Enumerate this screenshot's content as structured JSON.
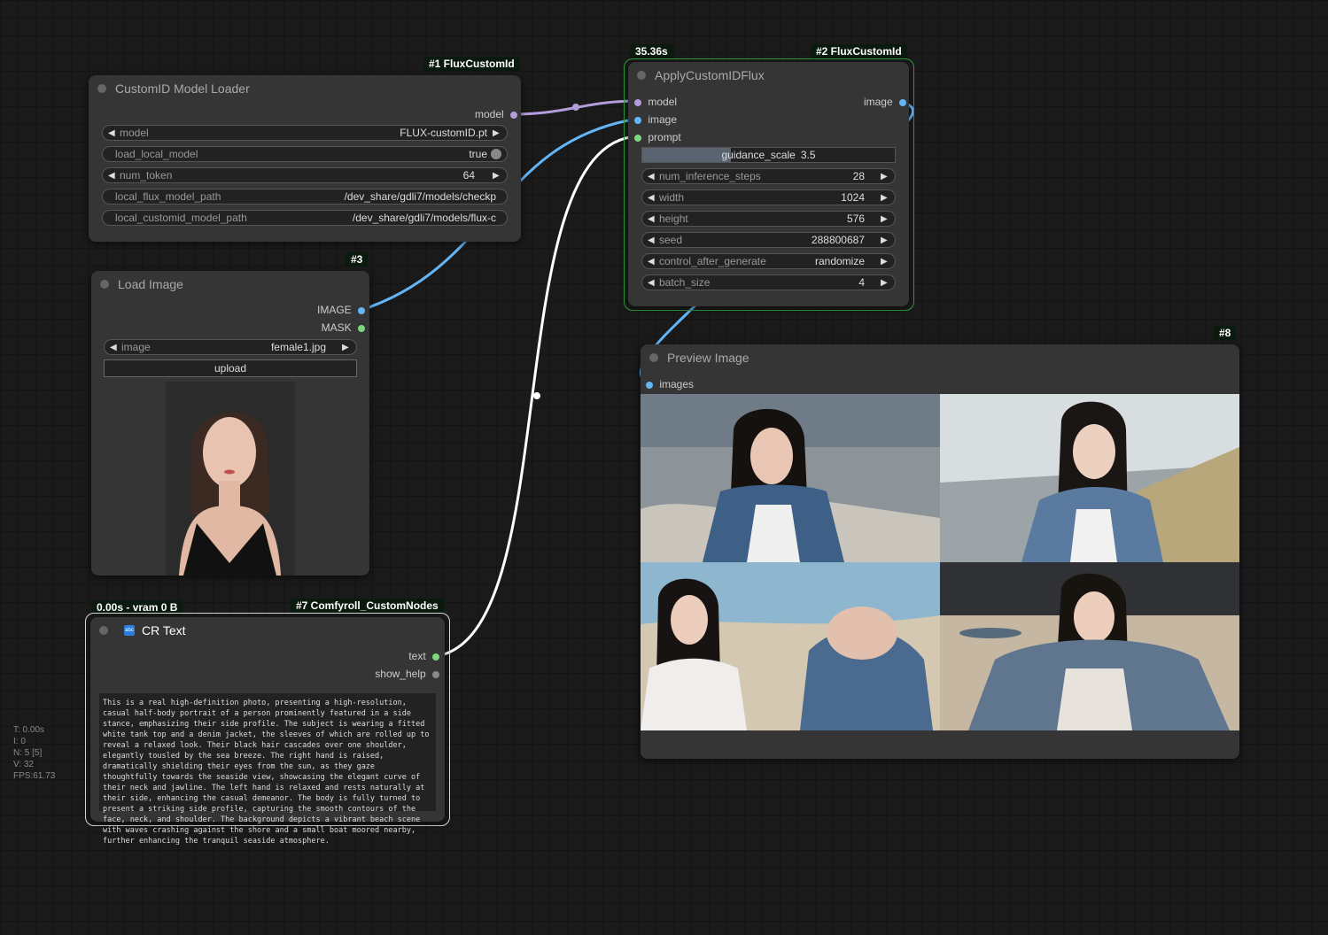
{
  "canvas_stats": {
    "t": "T: 0.00s",
    "i": "I: 0",
    "n": "N: 5 [5]",
    "v": "V: 32",
    "fps": "FPS:61.73"
  },
  "node1": {
    "badge": "#1 FluxCustomId",
    "title": "CustomID Model Loader",
    "output": "model",
    "widgets": {
      "model_label": "model",
      "model_value": "FLUX-customID.pt",
      "load_local_label": "load_local_model",
      "load_local_value": "true",
      "num_token_label": "num_token",
      "num_token_value": "64",
      "flux_path_label": "local_flux_model_path",
      "flux_path_value": "/dev_share/gdli7/models/checkp",
      "customid_path_label": "local_customid_model_path",
      "customid_path_value": "/dev_share/gdli7/models/flux-c"
    }
  },
  "node2": {
    "timing": "35.36s",
    "badge": "#2 FluxCustomId",
    "title": "ApplyCustomIDFlux",
    "inputs": {
      "model": "model",
      "image": "image",
      "prompt": "prompt"
    },
    "output": "image",
    "widgets": {
      "guidance_label": "guidance_scale",
      "guidance_value": "3.5",
      "guidance_fill": 0.35,
      "steps_label": "num_inference_steps",
      "steps_value": "28",
      "width_label": "width",
      "width_value": "1024",
      "height_label": "height",
      "height_value": "576",
      "seed_label": "seed",
      "seed_value": "288800687",
      "control_label": "control_after_generate",
      "control_value": "randomize",
      "batch_label": "batch_size",
      "batch_value": "4"
    }
  },
  "node3": {
    "badge": "#3",
    "title": "Load Image",
    "outputs": {
      "image": "IMAGE",
      "mask": "MASK"
    },
    "image_label": "image",
    "image_value": "female1.jpg",
    "upload_label": "upload"
  },
  "node7": {
    "timing": "0.00s - vram 0 B",
    "badge": "#7 Comfyroll_CustomNodes",
    "icon_text": "abc",
    "title": "CR Text",
    "outputs": {
      "text": "text",
      "show_help": "show_help"
    },
    "text": "This is a real high-definition photo, presenting a high-resolution, casual half-body portrait of a person prominently featured in a side stance, emphasizing their side profile. The subject is wearing a fitted white tank top and a denim jacket, the sleeves of which are rolled up to reveal a relaxed look. Their black hair cascades over one shoulder, elegantly tousled by the sea breeze. The right hand is raised, dramatically shielding their eyes from the sun, as they gaze thoughtfully towards the seaside view, showcasing the elegant curve of their neck and jawline. The left hand is relaxed and rests naturally at their side, enhancing the casual demeanor. The body is fully turned to present a striking side profile, capturing the smooth contours of the face, neck, and shoulder. The background depicts a vibrant beach scene with waves crashing against the shore and a small boat moored nearby, further enhancing the tranquil seaside atmosphere."
  },
  "node8": {
    "badge": "#8",
    "title": "Preview Image",
    "input": "images"
  },
  "colors": {
    "model_wire": "#b39ddb",
    "image_wire": "#64b5f6",
    "prompt_wire": "#ffffff",
    "running_border": "#2e9e3e",
    "bool_pin": "#7ed67e"
  }
}
